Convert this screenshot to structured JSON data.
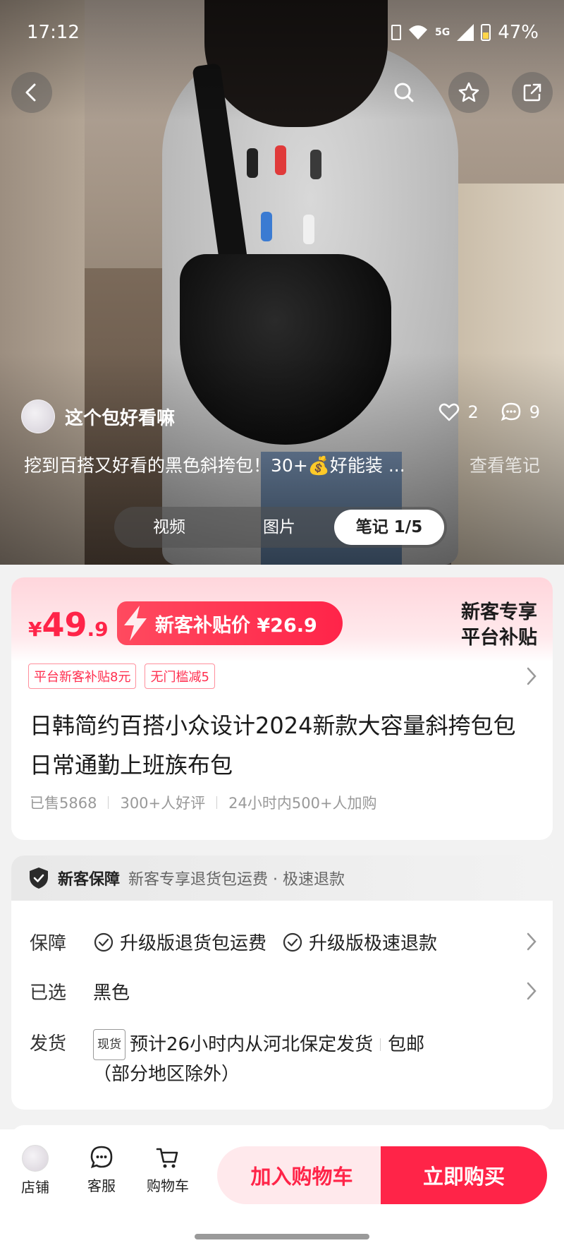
{
  "status": {
    "time": "17:12",
    "network": "5G",
    "battery": "47%"
  },
  "note": {
    "author": "这个包好看嘛",
    "likes": "2",
    "comments": "9",
    "caption": "挖到百搭又好看的黑色斜挎包！30+💰好能装 ...",
    "view_note": "查看笔记",
    "tabs": [
      "视频",
      "图片",
      "笔记 1/5"
    ]
  },
  "price": {
    "currency": "¥",
    "integer": "49",
    "decimal": ".9",
    "subsidy_label": "新客补贴价 ¥26.9",
    "platform_line1": "新客专享",
    "platform_line2": "平台补贴",
    "coupons": [
      "平台新客补贴8元",
      "无门槛减5"
    ]
  },
  "product": {
    "title": "日韩简约百搭小众设计2024新款大容量斜挎包包日常通勤上班族布包",
    "sold": "已售5868",
    "reviews": "300+人好评",
    "recent": "24小时内500+人加购"
  },
  "guarantee": {
    "head_title": "新客保障",
    "head_desc": "新客专享退货包运费 · 极速退款",
    "label_protect": "保障",
    "protect_1": "升级版退货包运费",
    "protect_2": "升级版极速退款",
    "label_selected": "已选",
    "selected_value": "黑色",
    "label_ship": "发货",
    "spot_tag": "现货",
    "ship_text": "预计26小时内从河北保定发货",
    "free_ship": "包邮",
    "ship_note": "（部分地区除外）"
  },
  "bottom": {
    "shop": "店铺",
    "service": "客服",
    "cart": "购物车",
    "add_cart": "加入购物车",
    "buy_now": "立即购买"
  },
  "colors": {
    "accent": "#ff2448",
    "accent_light": "#ffe9ec"
  }
}
